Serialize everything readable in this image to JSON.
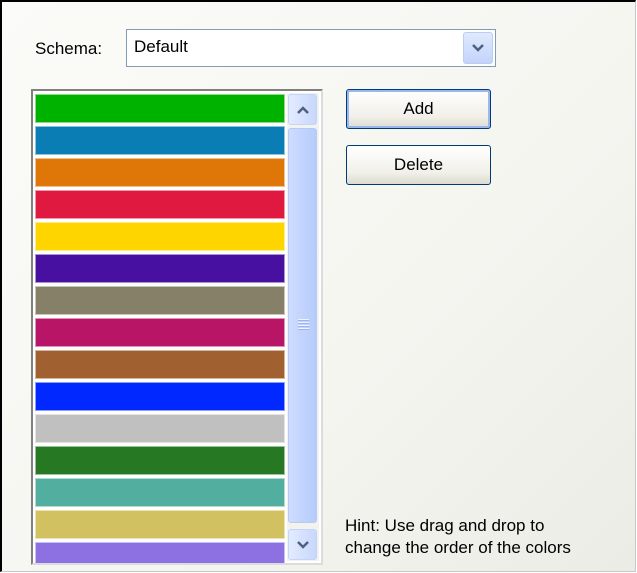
{
  "schema": {
    "label": "Schema:",
    "selected": "Default"
  },
  "colors": [
    "#00b200",
    "#0a7db5",
    "#de7707",
    "#e01940",
    "#ffd500",
    "#4710a0",
    "#878068",
    "#b91566",
    "#a0602f",
    "#0028ff",
    "#c0c0c0",
    "#267823",
    "#52ae9e",
    "#d2c161",
    "#8d71e2"
  ],
  "buttons": {
    "add": "Add",
    "delete": "Delete"
  },
  "hint": {
    "line1": "Hint: Use drag and drop to",
    "line2": "change the order of the colors"
  }
}
